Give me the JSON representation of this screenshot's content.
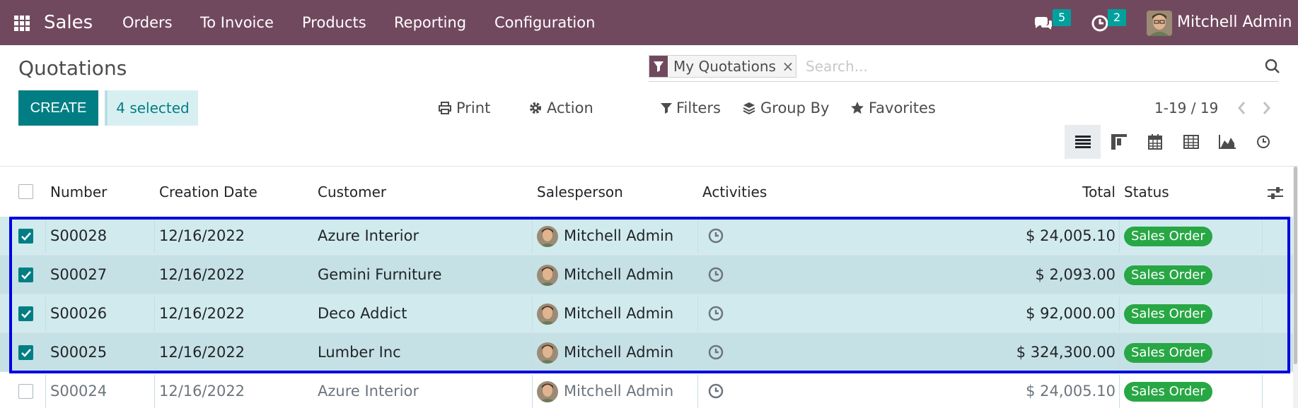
{
  "navbar": {
    "app_name": "Sales",
    "menu": [
      "Orders",
      "To Invoice",
      "Products",
      "Reporting",
      "Configuration"
    ],
    "messages_count": "5",
    "activities_count": "2",
    "user_name": "Mitchell Admin",
    "background_color": "#71495e",
    "badge_color": "#00a09d"
  },
  "control_panel": {
    "title": "Quotations",
    "create_label": "CREATE",
    "selected_label": "4 selected",
    "print_label": "Print",
    "action_label": "Action",
    "filters_label": "Filters",
    "group_by_label": "Group By",
    "favorites_label": "Favorites",
    "search_facet": "My Quotations",
    "search_placeholder": "Search...",
    "pager": "1-19 / 19",
    "views": [
      "list-view-icon",
      "kanban-view-icon",
      "calendar-view-icon",
      "pivot-view-icon",
      "graph-view-icon",
      "activity-view-icon"
    ],
    "active_view": "list",
    "accent_color": "#017e84"
  },
  "table": {
    "columns": [
      "Number",
      "Creation Date",
      "Customer",
      "Salesperson",
      "Activities",
      "Total",
      "Status"
    ],
    "rows": [
      {
        "number": "S00028",
        "date": "12/16/2022",
        "customer": "Azure Interior",
        "salesperson": "Mitchell Admin",
        "total": "$ 24,005.10",
        "status": "Sales Order",
        "checked": true
      },
      {
        "number": "S00027",
        "date": "12/16/2022",
        "customer": "Gemini Furniture",
        "salesperson": "Mitchell Admin",
        "total": "$ 2,093.00",
        "status": "Sales Order",
        "checked": true
      },
      {
        "number": "S00026",
        "date": "12/16/2022",
        "customer": "Deco Addict",
        "salesperson": "Mitchell Admin",
        "total": "$ 92,000.00",
        "status": "Sales Order",
        "checked": true
      },
      {
        "number": "S00025",
        "date": "12/16/2022",
        "customer": "Lumber Inc",
        "salesperson": "Mitchell Admin",
        "total": "$ 324,300.00",
        "status": "Sales Order",
        "checked": true
      },
      {
        "number": "S00024",
        "date": "12/16/2022",
        "customer": "Azure Interior",
        "salesperson": "Mitchell Admin",
        "total": "$ 24,005.10",
        "status": "Sales Order",
        "checked": false
      }
    ],
    "selected_row_color": "#d1eaee",
    "status_color": "#28a745",
    "highlight_color": "#0000e1"
  }
}
